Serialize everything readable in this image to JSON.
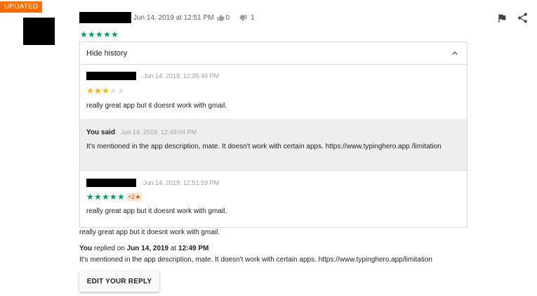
{
  "badge": "UPDATED",
  "review": {
    "date": "Jun 14, 2019 at 12:51 PM",
    "thumbs_up_count": "0",
    "thumbs_down_count": "1",
    "rating": 5,
    "star_glyph": "★"
  },
  "actions": {
    "flag_icon": "flag-icon",
    "share_icon": "share-icon"
  },
  "history": {
    "toggle_label": "Hide history",
    "entries": [
      {
        "date": "Jun 14, 2019, 12:35:46 PM",
        "rating": 3,
        "text": "really great app but it doesnt work with gmail."
      },
      {
        "author": "You said",
        "date": "Jun 14, 2019, 12:49:04 PM",
        "text": "It's mentioned in the app description, mate. It doesn't work with certain apps. https://www.typinghero.app /limitation"
      },
      {
        "date": "Jun 14, 2019, 12:51:59 PM",
        "rating": 5,
        "rating_change": "+2★",
        "text": "really great app but it doesnt work with gmail."
      }
    ]
  },
  "current_text": "really great app but it doesnt work with gmail.",
  "reply": {
    "you": "You",
    "replied_on": "replied on",
    "date": "Jun 14, 2019",
    "at": "at",
    "time": "12:49 PM",
    "text": "It's mentioned in the app description, mate. It doesn't work with certain apps. https://www.typinghero.app/limitation"
  },
  "edit_button_label": "EDIT YOUR REPLY",
  "colors": {
    "badge": "#ff6d00",
    "star_green": "#009e58",
    "star_yellow": "#f4b400",
    "star_empty": "#e0e0e0"
  }
}
